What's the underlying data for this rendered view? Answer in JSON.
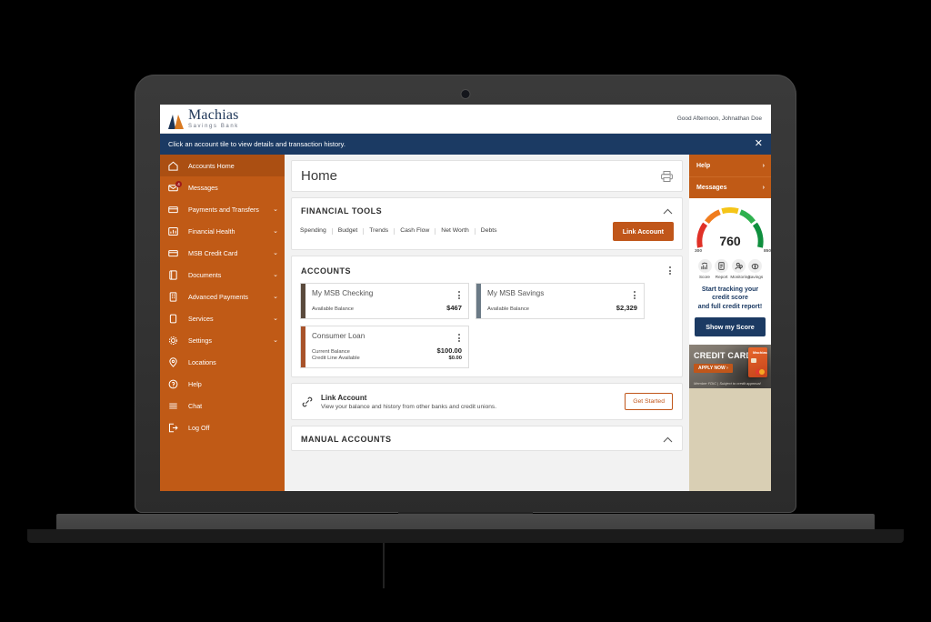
{
  "header": {
    "brand_name": "Machias",
    "brand_sub": "Savings Bank",
    "greeting": "Good Afternoon, Johnathan Doe"
  },
  "notice": {
    "text": "Click an account tile to view details and transaction history.",
    "close_label": "✕"
  },
  "sidebar": {
    "items": [
      {
        "label": "Accounts Home",
        "icon": "home-icon",
        "caret": "",
        "active": true,
        "badge": ""
      },
      {
        "label": "Messages",
        "icon": "envelope-icon",
        "caret": "",
        "active": false,
        "badge": "4"
      },
      {
        "label": "Payments and Transfers",
        "icon": "card-icon",
        "caret": "⌄",
        "active": false,
        "badge": ""
      },
      {
        "label": "Financial Health",
        "icon": "bar-chart-icon",
        "caret": "⌄",
        "active": false,
        "badge": ""
      },
      {
        "label": "MSB Credit Card",
        "icon": "credit-card-icon",
        "caret": "⌄",
        "active": false,
        "badge": ""
      },
      {
        "label": "Documents",
        "icon": "document-icon",
        "caret": "⌄",
        "active": false,
        "badge": ""
      },
      {
        "label": "Advanced Payments",
        "icon": "building-icon",
        "caret": "⌄",
        "active": false,
        "badge": ""
      },
      {
        "label": "Services",
        "icon": "clipboard-icon",
        "caret": "⌄",
        "active": false,
        "badge": ""
      },
      {
        "label": "Settings",
        "icon": "gear-icon",
        "caret": "⌄",
        "active": false,
        "badge": ""
      },
      {
        "label": "Locations",
        "icon": "map-pin-icon",
        "caret": "",
        "active": false,
        "badge": ""
      },
      {
        "label": "Help",
        "icon": "question-circle-icon",
        "caret": "",
        "active": false,
        "badge": ""
      },
      {
        "label": "Chat",
        "icon": "chat-lines-icon",
        "caret": "",
        "active": false,
        "badge": ""
      },
      {
        "label": "Log Off",
        "icon": "logout-icon",
        "caret": "",
        "active": false,
        "badge": ""
      }
    ]
  },
  "main": {
    "page_title": "Home",
    "print_icon": "printer-icon",
    "financial_tools": {
      "title": "FINANCIAL TOOLS",
      "tabs": [
        "Spending",
        "Budget",
        "Trends",
        "Cash Flow",
        "Net Worth",
        "Debts"
      ],
      "link_account_button": "Link Account"
    },
    "accounts": {
      "title": "ACCOUNTS",
      "tiles": [
        {
          "name": "My MSB Checking",
          "bar_color": "#5a4a3c",
          "rows": [
            {
              "label": "Available Balance",
              "value": "$467",
              "emphasis": "large"
            }
          ]
        },
        {
          "name": "My MSB Savings",
          "bar_color": "#6b7a86",
          "rows": [
            {
              "label": "Available Balance",
              "value": "$2,329",
              "emphasis": "large"
            }
          ]
        },
        {
          "name": "Consumer Loan",
          "bar_color": "#a8532a",
          "rows": [
            {
              "label": "Current Balance",
              "value": "$100.00",
              "emphasis": "large"
            },
            {
              "label": "Credit Line Available",
              "value": "$0.00",
              "emphasis": "small"
            }
          ]
        }
      ]
    },
    "link_account": {
      "icon": "link-chain-icon",
      "title": "Link Account",
      "description": "View your balance and history from other banks and credit unions.",
      "button": "Get Started"
    },
    "manual_accounts": {
      "title": "MANUAL ACCOUNTS"
    }
  },
  "rightpanel": {
    "links": [
      {
        "label": "Help",
        "chevron": "›"
      },
      {
        "label": "Messages",
        "chevron": "›"
      }
    ],
    "credit": {
      "score": "760",
      "range_min": "300",
      "range_max": "850",
      "icons": [
        {
          "label": "Score",
          "icon": "score-chart-icon"
        },
        {
          "label": "Report",
          "icon": "report-doc-icon"
        },
        {
          "label": "Monitoring",
          "icon": "monitoring-user-icon"
        },
        {
          "label": "Savings",
          "icon": "savings-money-icon"
        }
      ],
      "message_line1": "Start tracking your credit score",
      "message_line2": "and full credit report!",
      "cta": "Show my Score"
    },
    "ad": {
      "title": "CREDIT CARD",
      "cta": "APPLY NOW ›",
      "fine_print": "Member FDIC | Subject to credit approval",
      "card_logo": "Machias"
    }
  },
  "chart_data": {
    "type": "gauge",
    "title": "Credit Score",
    "value": 760,
    "range": [
      300,
      850
    ],
    "segments": [
      {
        "color": "#e03127",
        "from": 300,
        "to": 410
      },
      {
        "color": "#f07c1e",
        "from": 410,
        "to": 520
      },
      {
        "color": "#f5c518",
        "from": 520,
        "to": 630
      },
      {
        "color": "#2fb14e",
        "from": 630,
        "to": 740
      },
      {
        "color": "#0f8f3e",
        "from": 740,
        "to": 850
      }
    ],
    "tick_labels": [
      "300",
      "850"
    ]
  },
  "colors": {
    "brand_orange": "#c05a16",
    "navy": "#1b3a63",
    "page_bg": "#f2f2f2",
    "panel_beige": "#d9cfb4"
  }
}
